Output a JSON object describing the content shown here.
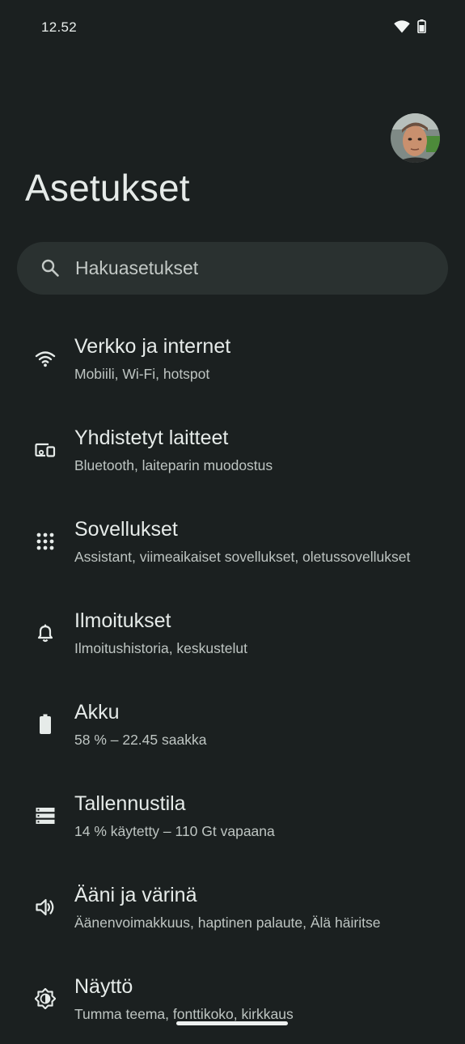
{
  "status_bar": {
    "time": "12.52",
    "icons": [
      "wifi-icon",
      "battery-icon"
    ]
  },
  "header": {
    "title": "Asetukset",
    "avatar": "profile-avatar"
  },
  "search": {
    "placeholder": "Hakuasetukset",
    "icon": "search-icon"
  },
  "settings": [
    {
      "icon": "wifi-icon",
      "title": "Verkko ja internet",
      "subtitle": "Mobiili, Wi-Fi, hotspot"
    },
    {
      "icon": "connected-devices-icon",
      "title": "Yhdistetyt laitteet",
      "subtitle": "Bluetooth, laiteparin muodostus"
    },
    {
      "icon": "apps-grid-icon",
      "title": "Sovellukset",
      "subtitle": "Assistant, viimeaikaiset sovellukset, oletussovellukset"
    },
    {
      "icon": "bell-icon",
      "title": "Ilmoitukset",
      "subtitle": "Ilmoitushistoria, keskustelut"
    },
    {
      "icon": "battery-icon",
      "title": "Akku",
      "subtitle": "58 % – 22.45 saakka"
    },
    {
      "icon": "storage-icon",
      "title": "Tallennustila",
      "subtitle": "14 % käytetty – 110 Gt vapaana"
    },
    {
      "icon": "volume-icon",
      "title": "Ääni ja värinä",
      "subtitle": "Äänenvoimakkuus, haptinen palaute, Älä häiritse"
    },
    {
      "icon": "brightness-icon",
      "title": "Näyttö",
      "subtitle": "Tumma teema, fonttikoko, kirkkaus"
    }
  ],
  "colors": {
    "background": "#1b2020",
    "search_background": "#2a3130",
    "text_primary": "#e6ebe9",
    "text_secondary": "#bec5c2"
  }
}
